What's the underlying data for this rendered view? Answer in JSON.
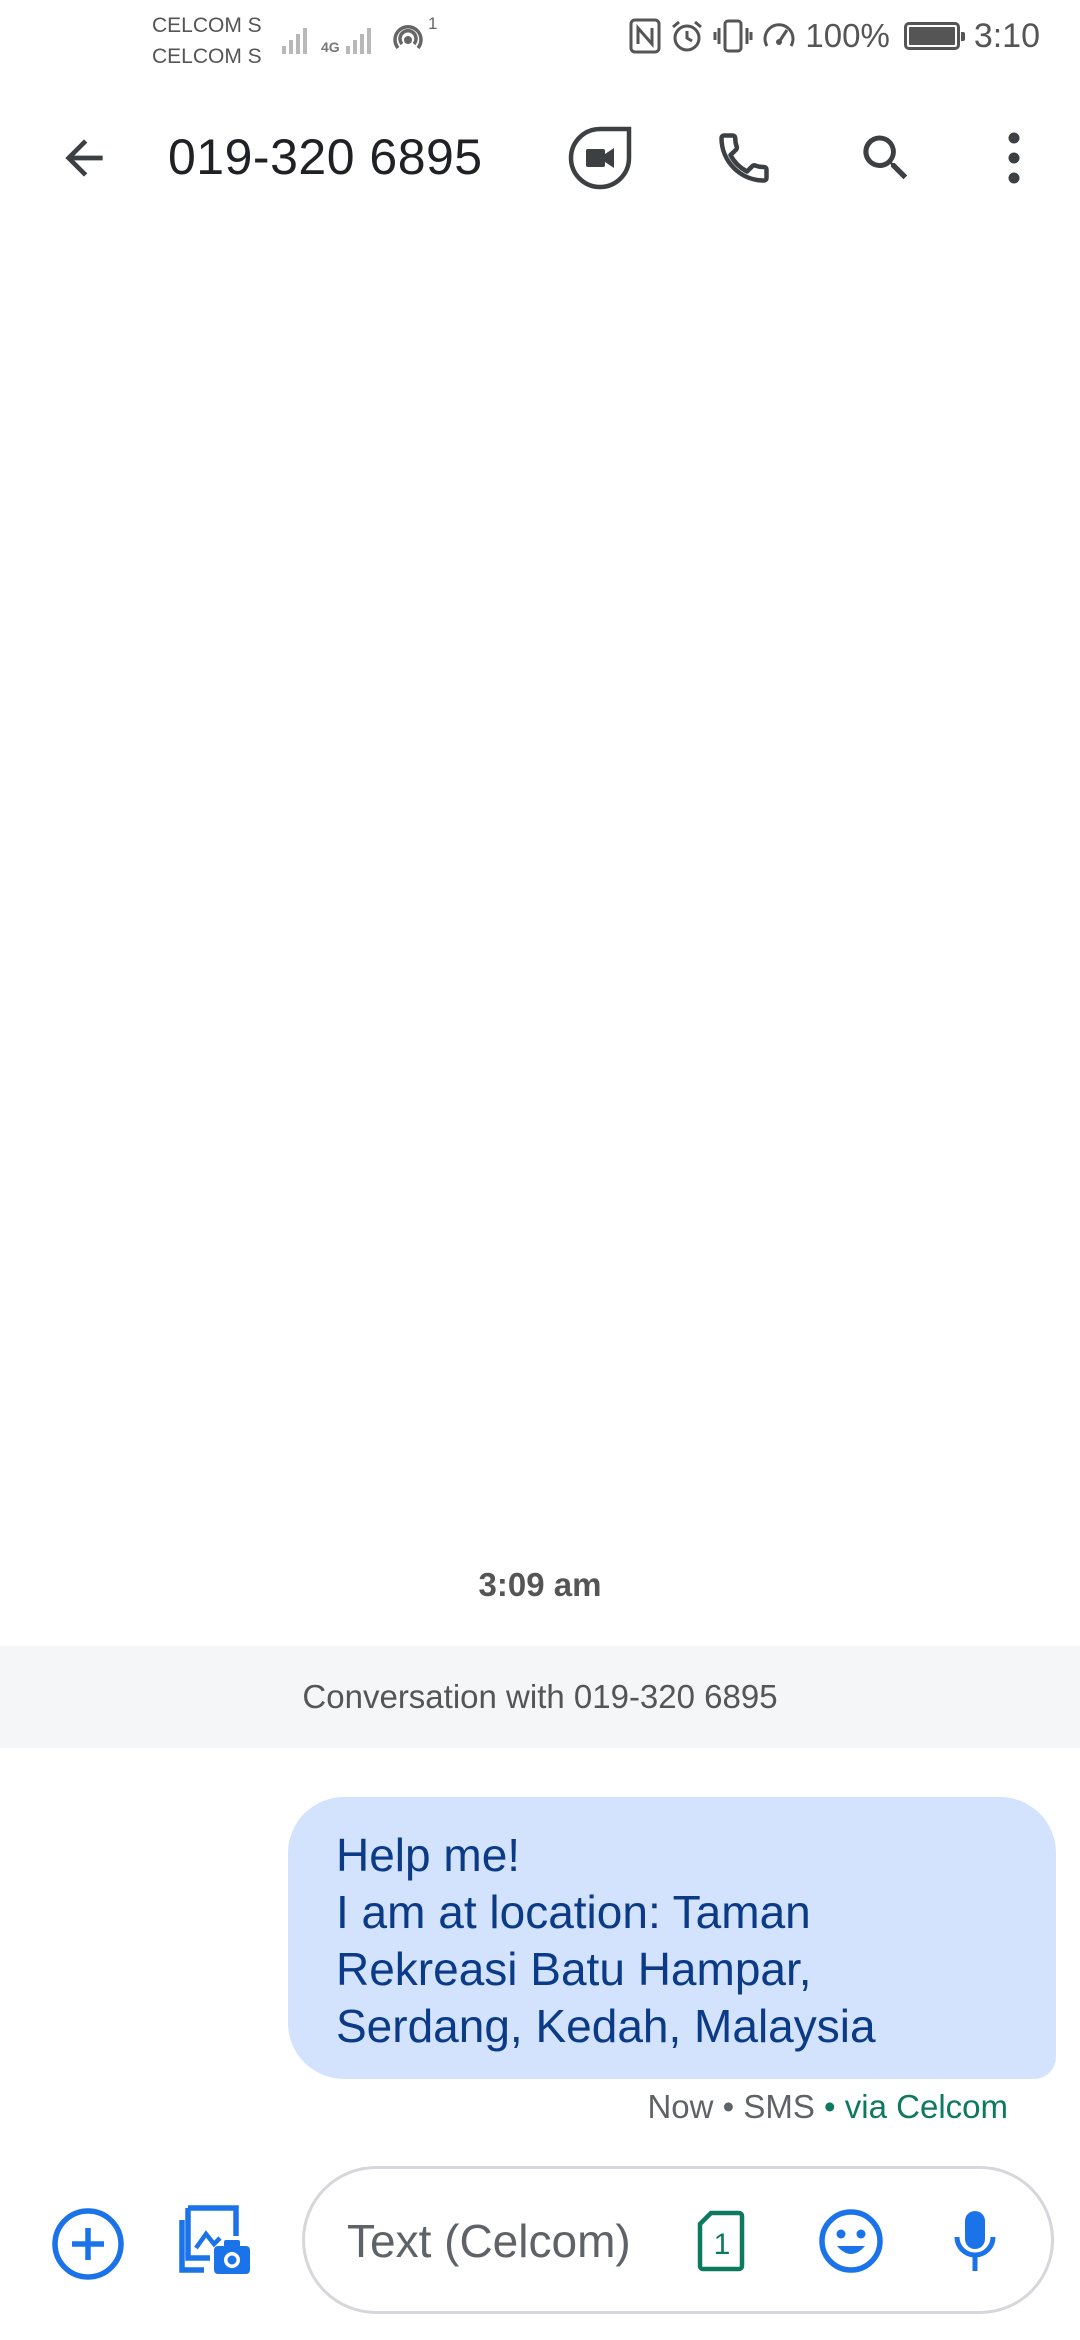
{
  "status_bar": {
    "carrier_1": "CELCOM St",
    "carrier_2": "CELCOM St",
    "network_type": "4G",
    "hotspot_count": "1",
    "battery_percent": "100%",
    "time": "3:10"
  },
  "app_bar": {
    "contact": "019-320 6895",
    "icons": [
      "arrow-back-icon",
      "video-call-icon",
      "phone-icon",
      "search-icon",
      "more-vert-icon"
    ]
  },
  "conversation": {
    "timestamp": "3:09 am",
    "banner": "Conversation with 019-320 6895",
    "messages": [
      {
        "lines": [
          "Help me!",
          "I am at location: Taman",
          "Rekreasi Batu Hampar,",
          "Serdang, Kedah, Malaysia"
        ],
        "status": "Now • SMS",
        "via": " • via Celcom"
      }
    ]
  },
  "composer": {
    "placeholder": "Text (Celcom)",
    "sim_label": "1"
  },
  "colors": {
    "accent": "#1a73e8",
    "bubble": "#d3e3fd",
    "bubble_text": "#0b3a86",
    "via_green": "#0d7a5f",
    "banner_bg": "#f5f6f8"
  }
}
